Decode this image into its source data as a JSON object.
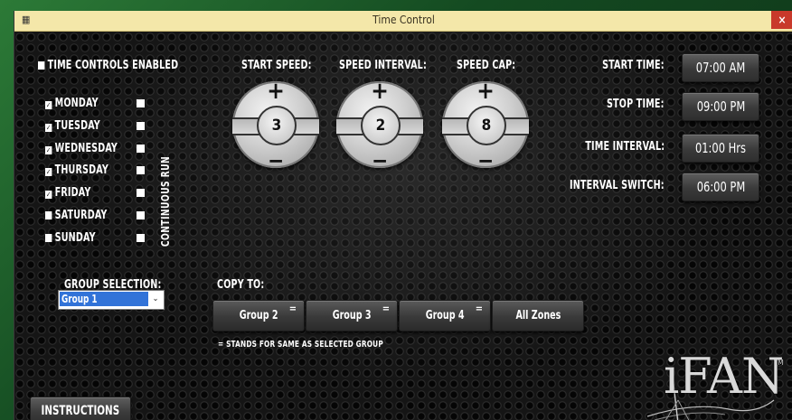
{
  "window": {
    "title": "Time Control",
    "close_label": "×"
  },
  "enable": {
    "label": "TIME CONTROLS ENABLED",
    "checked": false
  },
  "days": [
    {
      "label": "MONDAY",
      "checked": true,
      "continuous": false
    },
    {
      "label": "TUESDAY",
      "checked": true,
      "continuous": false
    },
    {
      "label": "WEDNESDAY",
      "checked": true,
      "continuous": false
    },
    {
      "label": "THURSDAY",
      "checked": true,
      "continuous": false
    },
    {
      "label": "FRIDAY",
      "checked": true,
      "continuous": false
    },
    {
      "label": "SATURDAY",
      "checked": false,
      "continuous": false
    },
    {
      "label": "SUNDAY",
      "checked": false,
      "continuous": false
    }
  ],
  "continuous_run_label": "CONTINUOUS RUN",
  "dials": [
    {
      "label": "START SPEED:",
      "value": "3",
      "plus": "+",
      "minus": "−"
    },
    {
      "label": "SPEED INTERVAL:",
      "value": "2",
      "plus": "+",
      "minus": "−"
    },
    {
      "label": "SPEED CAP:",
      "value": "8",
      "plus": "+",
      "minus": "−"
    }
  ],
  "times": [
    {
      "label": "START TIME:",
      "value": "07:00 AM"
    },
    {
      "label": "STOP TIME:",
      "value": "09:00 PM"
    },
    {
      "label": "TIME INTERVAL:",
      "value": "01:00 Hrs"
    },
    {
      "label": "INTERVAL SWITCH:",
      "value": "06:00 PM"
    }
  ],
  "group_selection": {
    "label": "GROUP SELECTION:",
    "selected": "Group 1"
  },
  "copy_to": {
    "label": "COPY TO:",
    "buttons": [
      {
        "label": "Group 2",
        "eq": "="
      },
      {
        "label": "Group 3",
        "eq": "="
      },
      {
        "label": "Group 4",
        "eq": "="
      },
      {
        "label": "All Zones",
        "eq": ""
      }
    ],
    "note": "= STANDS FOR SAME AS SELECTED GROUP"
  },
  "instructions_label": "INSTRUCTIONS",
  "logo": {
    "text": "iFAN",
    "tm": "TM"
  }
}
